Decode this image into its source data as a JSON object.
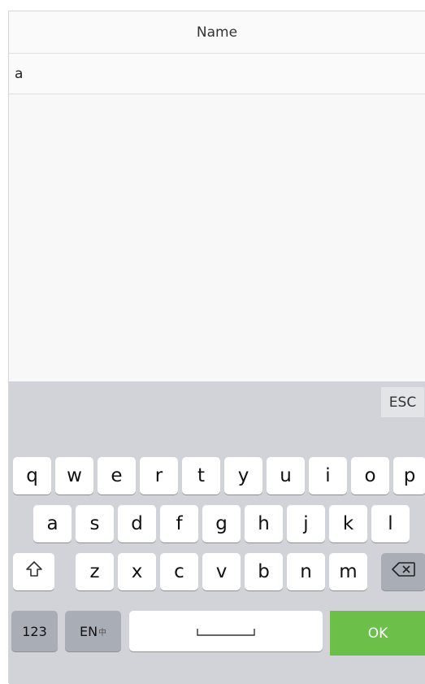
{
  "header": {
    "title": "Name"
  },
  "input": {
    "value": "a"
  },
  "candidate_bar": {
    "esc_label": "ESC"
  },
  "keyboard": {
    "row1": [
      "q",
      "w",
      "e",
      "r",
      "t",
      "y",
      "u",
      "i",
      "o",
      "p"
    ],
    "row2": [
      "a",
      "s",
      "d",
      "f",
      "g",
      "h",
      "j",
      "k",
      "l"
    ],
    "row3": [
      "z",
      "x",
      "c",
      "v",
      "b",
      "n",
      "m"
    ],
    "num_label": "123",
    "lang_label": "EN",
    "lang_alt": "中",
    "space_symbol": "␣",
    "ok_label": "OK",
    "shift_icon": "shift-icon",
    "backspace_icon": "backspace-icon"
  },
  "colors": {
    "keyboard_bg": "#d2d3d8",
    "ok_button": "#6cc04a"
  }
}
